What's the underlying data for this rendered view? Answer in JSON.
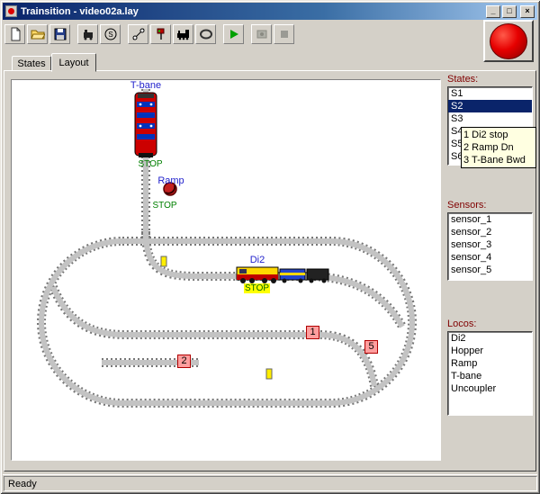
{
  "window": {
    "title": "Trainsition - video02a.lay",
    "status": "Ready",
    "controls": {
      "minimize": "_",
      "maximize": "□",
      "close": "×"
    }
  },
  "toolbar": {
    "icons": [
      "new-file",
      "open-file",
      "save-file",
      "locomotive-tool",
      "sensor-tool",
      "track-tool",
      "signal-tool",
      "train-tool",
      "tunnel-tool",
      "run",
      "step",
      "stop"
    ]
  },
  "emergency_button": {
    "color": "#e60000",
    "name": "emergency-stop"
  },
  "tabs": [
    {
      "label": "States",
      "active": false
    },
    {
      "label": "Layout",
      "active": true
    }
  ],
  "layout": {
    "labels": {
      "tbane": "T-bane",
      "tbane_stop": "STOP",
      "ramp": "Ramp",
      "ramp_stop": "STOP",
      "di2": "Di2",
      "di2_stop": "STOP"
    },
    "markers": [
      "1",
      "2",
      "5"
    ]
  },
  "panels": {
    "states": {
      "label": "States:",
      "items": [
        {
          "label": "S1",
          "selected": false
        },
        {
          "label": "S2",
          "selected": true
        },
        {
          "label": "S3",
          "selected": false
        },
        {
          "label": "S4",
          "selected": false
        },
        {
          "label": "S5",
          "selected": false
        },
        {
          "label": "S6",
          "selected": false
        }
      ]
    },
    "sensors": {
      "label": "Sensors:",
      "items": [
        "sensor_1",
        "sensor_2",
        "sensor_3",
        "sensor_4",
        "sensor_5"
      ]
    },
    "locos": {
      "label": "Locos:",
      "items": [
        "Di2",
        "Hopper",
        "Ramp",
        "T-bane",
        "Uncoupler"
      ]
    }
  },
  "tooltip": {
    "lines": [
      "1  Di2 stop",
      "2  Ramp Dn",
      "3  T-Bane Bwd"
    ]
  }
}
